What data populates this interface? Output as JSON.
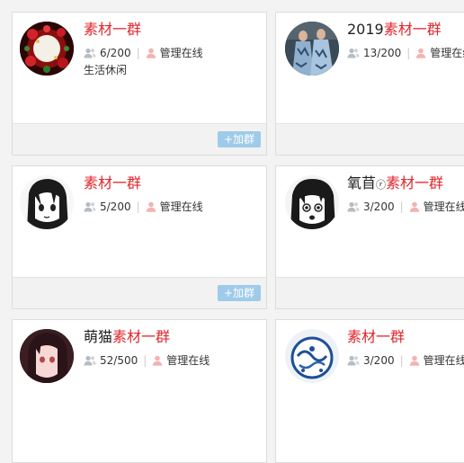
{
  "highlight_color": "#e0262b",
  "button_color": "#9ecbe9",
  "groups": [
    {
      "name_prefix": "",
      "name_highlight": "素材一群",
      "members": "6/200",
      "admin_status": "管理在线",
      "description": "生活休闲",
      "join_label": "+加群",
      "avatar": "red-rose-frame"
    },
    {
      "name_prefix": "2019",
      "name_highlight": "素材一群",
      "members": "13/200",
      "admin_status": "管理在线",
      "description": "",
      "join_label": "",
      "avatar": "blue-dress-models"
    },
    {
      "name_prefix": "",
      "name_highlight": "素材一群",
      "members": "5/200",
      "admin_status": "管理在线",
      "description": "",
      "join_label": "+加群",
      "avatar": "anime-girl-sketch"
    },
    {
      "name_prefix": "氧苜",
      "name_mid": "ⓡ",
      "name_highlight": "素材一群",
      "members": "3/200",
      "admin_status": "管理在线",
      "description": "",
      "join_label": "",
      "avatar": "anime-girl-surprised"
    },
    {
      "name_prefix": "萌猫",
      "name_highlight": "素材一群",
      "members": "52/500",
      "admin_status": "管理在线",
      "description": "",
      "join_label": "",
      "avatar": "anime-girl-pink"
    },
    {
      "name_prefix": "",
      "name_highlight": "素材一群",
      "members": "3/200",
      "admin_status": "管理在线",
      "description": "",
      "join_label": "",
      "avatar": "blue-porcelain"
    }
  ]
}
